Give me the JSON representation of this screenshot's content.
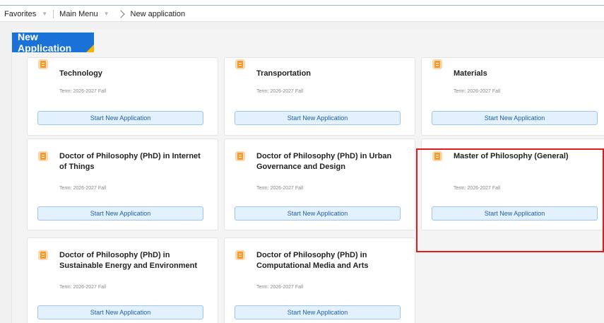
{
  "nav": {
    "favorites": "Favorites",
    "main_menu": "Main Menu",
    "current": "New application"
  },
  "header_tag": "New Application",
  "term_text": "Term: 2026-2027 Fall",
  "button_label": "Start New Application",
  "cards": [
    {
      "title": "Technology"
    },
    {
      "title": "Transportation"
    },
    {
      "title": "Materials"
    },
    {
      "title": "Doctor of Philosophy (PhD) in Internet of Things"
    },
    {
      "title": "Doctor of Philosophy (PhD) in Urban Governance and Design"
    },
    {
      "title": "Master of Philosophy (General)"
    },
    {
      "title": "Doctor of Philosophy (PhD) in Sustainable Energy and Environment"
    },
    {
      "title": "Doctor of Philosophy (PhD) in Computational Media and Arts"
    }
  ],
  "colors": {
    "accent": "#1a72d8",
    "tag_corner": "#f5b400",
    "button_bg": "#e3f0fd",
    "highlight": "#e11b1b"
  }
}
